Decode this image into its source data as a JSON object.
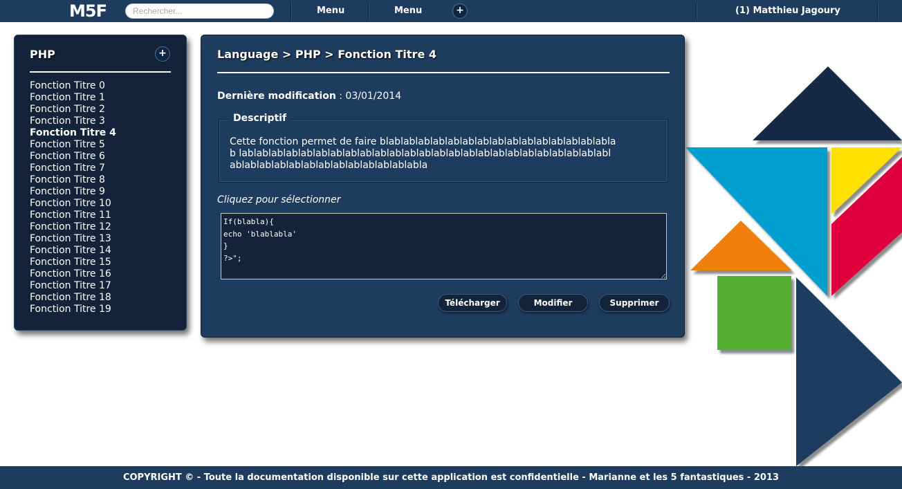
{
  "header": {
    "logo": "M5F",
    "search_placeholder": "Rechercher...",
    "menu_1": "Menu",
    "menu_2": "Menu",
    "add_label": "+",
    "user": "(1) Matthieu Jagoury"
  },
  "sidebar": {
    "title": "PHP",
    "add_label": "+",
    "items": [
      "Fonction Titre 0",
      "Fonction Titre 1",
      "Fonction Titre 2",
      "Fonction Titre 3",
      "Fonction Titre 4",
      "Fonction Titre 5",
      "Fonction Titre 6",
      "Fonction Titre 7",
      "Fonction Titre 8",
      "Fonction Titre 9",
      "Fonction Titre 10",
      "Fonction Titre 11",
      "Fonction Titre 12",
      "Fonction Titre 13",
      "Fonction Titre 14",
      "Fonction Titre 15",
      "Fonction Titre 16",
      "Fonction Titre 17",
      "Fonction Titre 18",
      "Fonction Titre 19"
    ],
    "active_index": 4
  },
  "main": {
    "breadcrumb": "Language > PHP > Fonction Titre 4",
    "last_modified_label": "Dernière modification",
    "last_modified_sep": " : ",
    "last_modified_value": "03/01/2014",
    "description_legend": "Descriptif",
    "description_text": "Cette fonction permet de faire blablablablablablablablablablablablablablablablab lablablablablablablablablablablablablablablablablablablablablablablablablabl ablablablablablablablablablablablablabla",
    "select_hint": "Cliquez pour sélectionner",
    "code": "If(blabla){\necho 'blablabla'\n}\n?>\";",
    "buttons": {
      "download": "Télécharger",
      "edit": "Modifier",
      "delete": "Supprimer"
    }
  },
  "decoration": {
    "colors": {
      "navy_dark": "#152a45",
      "blue": "#009fcf",
      "yellow": "#ffe000",
      "red": "#e0003c",
      "orange": "#f08010",
      "green": "#52ae32",
      "navy": "#1e3c5e"
    }
  },
  "footer": {
    "copyright": "COPYRIGHT © - Toute la documentation disponible sur cette application est confidentielle - Marianne et les 5 fantastiques - 2013"
  }
}
